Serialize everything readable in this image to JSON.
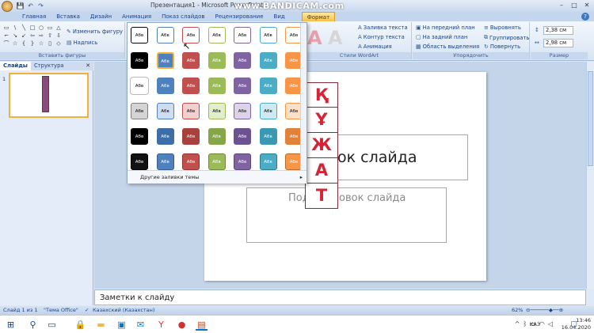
{
  "window": {
    "title": "Презентация1 - Microsoft PowerPoint",
    "watermark": "www.BANDICAM.com"
  },
  "qat": {
    "save_icon": "💾",
    "undo_icon": "↶",
    "redo_icon": "↷"
  },
  "window_controls": {
    "minimize": "–",
    "maximize": "□",
    "close": "✕"
  },
  "tabs": [
    {
      "label": "Главная"
    },
    {
      "label": "Вставка"
    },
    {
      "label": "Дизайн"
    },
    {
      "label": "Анимация"
    },
    {
      "label": "Показ слайдов"
    },
    {
      "label": "Рецензирование"
    },
    {
      "label": "Вид"
    },
    {
      "label": "Формат"
    }
  ],
  "ribbon": {
    "group_insert_shapes": "Вставить фигуры",
    "change_shape": "Изменить фигуру",
    "text_box": "Надпись",
    "group_wordart": "Стили WordArt",
    "text_fill": "Заливка текста",
    "text_outline": "Контур текста",
    "animation": "Анимация",
    "group_arrange": "Упорядочить",
    "bring_front": "На передний план",
    "send_back": "На задний план",
    "selection_pane": "Область выделения",
    "align": "Выровнять",
    "group": "Группировать",
    "rotate": "Повернуть",
    "group_size": "Размер",
    "height": "2,38 см",
    "width": "2,98 см",
    "wordart_letter": "A"
  },
  "shapes_gallery": [
    "▭",
    "\\",
    "╲",
    "□",
    "○",
    "▭",
    "△",
    "⌐",
    "↘",
    "↙",
    "⇦",
    "⇨",
    "⇧",
    "⇩",
    "⌒",
    "☆",
    "{",
    "}",
    "☆",
    "▯",
    "◇"
  ],
  "style_gallery": {
    "cell_label": "Абв",
    "more_fills": "Другие заливки темы",
    "rows": [
      [
        {
          "fill": "#ffffff",
          "border": "#000000",
          "text": "#000000"
        },
        {
          "fill": "#ffffff",
          "border": "#4f81bd",
          "text": "#000000"
        },
        {
          "fill": "#ffffff",
          "border": "#c0504d",
          "text": "#000000"
        },
        {
          "fill": "#ffffff",
          "border": "#9bbb59",
          "text": "#000000"
        },
        {
          "fill": "#ffffff",
          "border": "#8064a2",
          "text": "#000000"
        },
        {
          "fill": "#ffffff",
          "border": "#4bacc6",
          "text": "#000000"
        },
        {
          "fill": "#ffffff",
          "border": "#f79646",
          "text": "#000000"
        }
      ],
      [
        {
          "fill": "#000000",
          "border": "#000000",
          "text": "#ffffff"
        },
        {
          "fill": "#4f81bd",
          "border": "#f0b13a",
          "text": "#ffffff"
        },
        {
          "fill": "#c0504d",
          "border": "#c0504d",
          "text": "#ffffff"
        },
        {
          "fill": "#9bbb59",
          "border": "#9bbb59",
          "text": "#ffffff"
        },
        {
          "fill": "#8064a2",
          "border": "#8064a2",
          "text": "#ffffff"
        },
        {
          "fill": "#4bacc6",
          "border": "#4bacc6",
          "text": "#ffffff"
        },
        {
          "fill": "#f79646",
          "border": "#f79646",
          "text": "#ffffff"
        }
      ],
      [
        {
          "fill": "#ffffff",
          "border": "#ffffff",
          "text": "#000000"
        },
        {
          "fill": "#4f81bd",
          "border": "#4f81bd",
          "text": "#ffffff"
        },
        {
          "fill": "#c0504d",
          "border": "#c0504d",
          "text": "#ffffff"
        },
        {
          "fill": "#9bbb59",
          "border": "#9bbb59",
          "text": "#ffffff"
        },
        {
          "fill": "#8064a2",
          "border": "#8064a2",
          "text": "#ffffff"
        },
        {
          "fill": "#4bacc6",
          "border": "#4bacc6",
          "text": "#ffffff"
        },
        {
          "fill": "#f79646",
          "border": "#f79646",
          "text": "#ffffff"
        }
      ],
      [
        {
          "fill": "#d4d4d4",
          "border": "#7f7f7f",
          "text": "#000000"
        },
        {
          "fill": "#d0dcf0",
          "border": "#4f81bd",
          "text": "#000000"
        },
        {
          "fill": "#f2d0cf",
          "border": "#c0504d",
          "text": "#000000"
        },
        {
          "fill": "#e2edcc",
          "border": "#9bbb59",
          "text": "#000000"
        },
        {
          "fill": "#dcd3e6",
          "border": "#8064a2",
          "text": "#000000"
        },
        {
          "fill": "#cfe9f1",
          "border": "#4bacc6",
          "text": "#000000"
        },
        {
          "fill": "#fce0c8",
          "border": "#f79646",
          "text": "#000000"
        }
      ],
      [
        {
          "fill": "#000000",
          "border": "#000000",
          "text": "#ffffff"
        },
        {
          "fill": "#3e6ea8",
          "border": "#3e6ea8",
          "text": "#ffffff"
        },
        {
          "fill": "#a8403d",
          "border": "#a8403d",
          "text": "#ffffff"
        },
        {
          "fill": "#86a64a",
          "border": "#86a64a",
          "text": "#ffffff"
        },
        {
          "fill": "#6c5290",
          "border": "#6c5290",
          "text": "#ffffff"
        },
        {
          "fill": "#3b98b2",
          "border": "#3b98b2",
          "text": "#ffffff"
        },
        {
          "fill": "#e0823a",
          "border": "#e0823a",
          "text": "#ffffff"
        }
      ],
      [
        {
          "fill": "#111111",
          "border": "#000000",
          "text": "#ffffff"
        },
        {
          "fill": "#4f81bd",
          "border": "#355d8d",
          "text": "#ffffff"
        },
        {
          "fill": "#c0504d",
          "border": "#8f3533",
          "text": "#ffffff"
        },
        {
          "fill": "#9bbb59",
          "border": "#6f8a3a",
          "text": "#ffffff"
        },
        {
          "fill": "#8064a2",
          "border": "#5c4577",
          "text": "#ffffff"
        },
        {
          "fill": "#4bacc6",
          "border": "#2f7d93",
          "text": "#ffffff"
        },
        {
          "fill": "#f79646",
          "border": "#b96a27",
          "text": "#ffffff"
        }
      ]
    ]
  },
  "panel": {
    "tab_slides": "Слайды",
    "tab_outline": "Структура",
    "close": "✕",
    "slide_number": "1"
  },
  "slide": {
    "title_visible": "ок слайда",
    "subtitle_visible": "Подзаголовок слайда",
    "subtitle_hidden_part": "Под",
    "subtitle_rest": "овок слайда",
    "letters": [
      "Қ",
      "Ұ",
      "Ж",
      "А",
      "Т"
    ]
  },
  "notes": {
    "placeholder": "Заметки к слайду"
  },
  "status": {
    "slide": "Слайд 1 из 1",
    "theme": "\"Тема Office\"",
    "language": "Казахский (Казахстан)",
    "zoom": "62%"
  },
  "taskbar": {
    "time": "13:46",
    "date": "16.04.2020",
    "lang": "КАЗ"
  },
  "colors": {
    "accent_tab": "#f6c04a",
    "letter_red": "#d62434",
    "ribbon_text": "#15428b"
  }
}
